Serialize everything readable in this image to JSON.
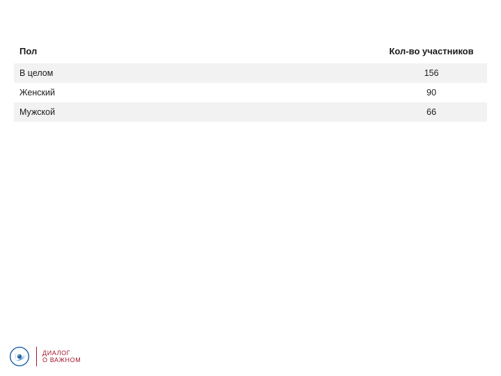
{
  "table": {
    "headers": {
      "category": "Пол",
      "count": "Кол-во участников"
    },
    "rows": [
      {
        "category": "В целом",
        "count": "156"
      },
      {
        "category": "Женский",
        "count": "90"
      },
      {
        "category": "Мужской",
        "count": "66"
      }
    ]
  },
  "footer": {
    "line1": "ДИАЛОГ",
    "line2": "О ВАЖНОМ"
  },
  "colors": {
    "accent": "#a0152b",
    "logo_primary": "#1b5fa6",
    "logo_secondary": "#3a8fd6"
  },
  "chart_data": {
    "type": "table",
    "title": "",
    "columns": [
      "Пол",
      "Кол-во участников"
    ],
    "rows": [
      [
        "В целом",
        156
      ],
      [
        "Женский",
        90
      ],
      [
        "Мужской",
        66
      ]
    ]
  }
}
